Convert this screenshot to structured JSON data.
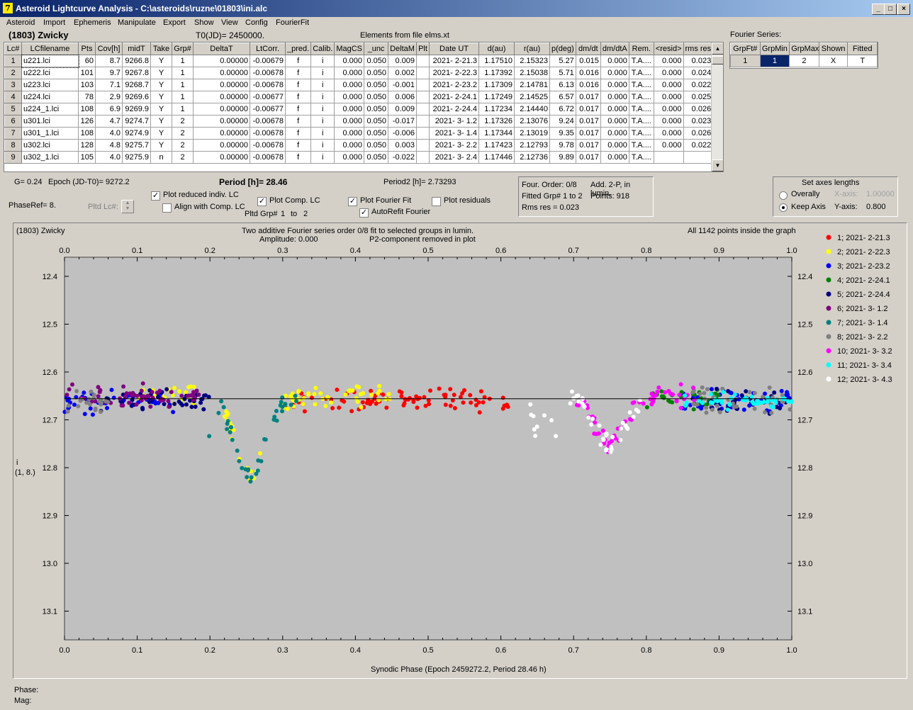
{
  "window": {
    "title": "Asteroid Lightcurve Analysis - C:\\asteroids\\ruzne\\01803\\ini.alc",
    "min": "_",
    "max": "□",
    "close": "×"
  },
  "menu": [
    "Asteroid",
    "Import",
    "Ephemeris",
    "Manipulate",
    "Export",
    "Show",
    "View",
    "Config",
    "FourierFit"
  ],
  "header": {
    "asteroid": "(1803) Zwicky",
    "t0": "T0(JD)= 2450000.",
    "elements": "Elements from file elms.xt",
    "fourier_label": "Fourier Series:"
  },
  "lc_table": {
    "columns": [
      "Lc#",
      "LCfilename",
      "Pts",
      "Cov[h]",
      "midT",
      "Take",
      "Grp#",
      "DeltaT",
      "LtCorr.",
      "_pred.",
      "Calib.",
      "MagCS",
      "_unc",
      "DeltaM",
      "Plt",
      "Date UT",
      "d(au)",
      "r(au)",
      "p(deg)",
      "dm/dt",
      "dm/dtA",
      "Rem.",
      "<resid>",
      "rms res"
    ],
    "rows": [
      [
        "1",
        "u221.lci",
        "60",
        "8.7",
        "9266.8",
        "Y",
        "1",
        "0.00000",
        "-0.00679",
        "f",
        "i",
        "0.000",
        "0.050",
        "0.009",
        "",
        "2021- 2-21.3",
        "1.17510",
        "2.15323",
        "5.27",
        "0.015",
        "0.000",
        "T.A....",
        "0.000",
        "0.023"
      ],
      [
        "2",
        "u222.lci",
        "101",
        "9.7",
        "9267.8",
        "Y",
        "1",
        "0.00000",
        "-0.00678",
        "f",
        "i",
        "0.000",
        "0.050",
        "0.002",
        "",
        "2021- 2-22.3",
        "1.17392",
        "2.15038",
        "5.71",
        "0.016",
        "0.000",
        "T.A....",
        "0.000",
        "0.024"
      ],
      [
        "3",
        "u223.lci",
        "103",
        "7.1",
        "9268.7",
        "Y",
        "1",
        "0.00000",
        "-0.00678",
        "f",
        "i",
        "0.000",
        "0.050",
        "-0.001",
        "",
        "2021- 2-23.2",
        "1.17309",
        "2.14781",
        "6.13",
        "0.016",
        "0.000",
        "T.A....",
        "0.000",
        "0.022"
      ],
      [
        "4",
        "u224.lci",
        "78",
        "2.9",
        "9269.6",
        "Y",
        "1",
        "0.00000",
        "-0.00677",
        "f",
        "i",
        "0.000",
        "0.050",
        "0.006",
        "",
        "2021- 2-24.1",
        "1.17249",
        "2.14525",
        "6.57",
        "0.017",
        "0.000",
        "T.A....",
        "0.000",
        "0.025"
      ],
      [
        "5",
        "u224_1.lci",
        "108",
        "6.9",
        "9269.9",
        "Y",
        "1",
        "0.00000",
        "-0.00677",
        "f",
        "i",
        "0.000",
        "0.050",
        "0.009",
        "",
        "2021- 2-24.4",
        "1.17234",
        "2.14440",
        "6.72",
        "0.017",
        "0.000",
        "T.A....",
        "0.000",
        "0.026"
      ],
      [
        "6",
        "u301.lci",
        "126",
        "4.7",
        "9274.7",
        "Y",
        "2",
        "0.00000",
        "-0.00678",
        "f",
        "i",
        "0.000",
        "0.050",
        "-0.017",
        "",
        "2021- 3- 1.2",
        "1.17326",
        "2.13076",
        "9.24",
        "0.017",
        "0.000",
        "T.A....",
        "0.000",
        "0.023"
      ],
      [
        "7",
        "u301_1.lci",
        "108",
        "4.0",
        "9274.9",
        "Y",
        "2",
        "0.00000",
        "-0.00678",
        "f",
        "i",
        "0.000",
        "0.050",
        "-0.006",
        "",
        "2021- 3- 1.4",
        "1.17344",
        "2.13019",
        "9.35",
        "0.017",
        "0.000",
        "T.A....",
        "0.000",
        "0.026"
      ],
      [
        "8",
        "u302.lci",
        "128",
        "4.8",
        "9275.7",
        "Y",
        "2",
        "0.00000",
        "-0.00678",
        "f",
        "i",
        "0.000",
        "0.050",
        "0.003",
        "",
        "2021- 3- 2.2",
        "1.17423",
        "2.12793",
        "9.78",
        "0.017",
        "0.000",
        "T.A....",
        "0.000",
        "0.022"
      ],
      [
        "9",
        "u302_1.lci",
        "105",
        "4.0",
        "9275.9",
        "n",
        "2",
        "0.00000",
        "-0.00678",
        "f",
        "i",
        "0.000",
        "0.050",
        "-0.022",
        "",
        "2021- 3- 2.4",
        "1.17446",
        "2.12736",
        "9.89",
        "0.017",
        "0.000",
        "T.A....",
        "",
        ""
      ]
    ]
  },
  "fourier_table": {
    "columns": [
      "GrpFt#",
      "GrpMin",
      "GrpMax",
      "Shown",
      "Fitted"
    ],
    "row": [
      "1",
      "1",
      "2",
      "X",
      "T"
    ]
  },
  "params": {
    "g": "G= 0.24",
    "epoch": "Epoch (JD-T0)= 9272.2",
    "period": "Period [h]= 28.46",
    "period2": "Period2 [h]= 2.73293",
    "phaseref": "PhaseRef= 8.",
    "pltd_lc": "Pltd Lc#:",
    "plot_reduced": "Plot reduced indiv. LC",
    "align_comp": "Align with Comp. LC",
    "plot_comp": "Plot Comp. LC",
    "pltd_grp": "Pltd Grp#",
    "grp_from": "1",
    "grp_to_lbl": "to",
    "grp_to": "2",
    "plot_fourier": "Plot Fourier Fit",
    "autorefit": "AutoRefit Fourier",
    "plot_resid": "Plot residuals",
    "four_order": "Four. Order:  0/8",
    "add2p": "Add. 2-P, in lumin.",
    "fitted_grp": "Fitted Grp# 1 to 2",
    "points": "Points: 918",
    "rms": "Rms res     = 0.023",
    "axes_title": "Set axes lengths",
    "overally": "Overally",
    "keep_axis": "Keep Axis",
    "xaxis_lbl": "X-axis:",
    "xaxis_val": "1.00000",
    "yaxis_lbl": "Y-axis:",
    "yaxis_val": "0.800",
    "checks": {
      "plot_reduced": true,
      "align_comp": false,
      "plot_comp": true,
      "plot_fourier": true,
      "autorefit": true,
      "plot_resid": false
    }
  },
  "plot": {
    "name": "(1803) Zwicky",
    "title1": "Two additive Fourier series order 0/8 fit to selected groups in lumin.",
    "title2a": "Amplitude: 0.000",
    "title2b": "P2-component removed in plot",
    "inside": "All 1142 points inside the graph",
    "ylabel1": "i",
    "ylabel2": "(1, 8.)",
    "xlabel": "Synodic Phase (Epoch 2459272.2, Period 28.46 h)",
    "phase_lbl": "Phase:",
    "mag_lbl": "Mag:"
  },
  "chart_data": {
    "type": "scatter",
    "xlabel": "Synodic Phase (Epoch 2459272.2, Period 28.46 h)",
    "ylabel": "i",
    "xlim": [
      0,
      1
    ],
    "ylim": [
      12.36,
      13.16
    ],
    "y_inverted": true,
    "xticks": [
      "0.0",
      "0.1",
      "0.2",
      "0.3",
      "0.4",
      "0.5",
      "0.6",
      "0.7",
      "0.8",
      "0.9",
      "1.0"
    ],
    "yticks": [
      "12.4",
      "12.5",
      "12.6",
      "12.7",
      "12.8",
      "12.9",
      "13.0",
      "13.1"
    ],
    "fit_line_mag": 12.656,
    "series": [
      {
        "name": "1; 2021- 2-21.3",
        "color": "#ff0000",
        "ranges": [
          [
            0.3,
            0.61,
            12.66,
            0.03
          ]
        ]
      },
      {
        "name": "2; 2021- 2-22.3",
        "color": "#ffff00",
        "ranges": [
          [
            0.1,
            0.18,
            12.65,
            0.03
          ],
          [
            0.22,
            0.27,
            12.79,
            0.02
          ],
          [
            0.3,
            0.45,
            12.65,
            0.03
          ]
        ]
      },
      {
        "name": "3; 2021- 2-23.2",
        "color": "#0000ff",
        "ranges": [
          [
            0.0,
            0.15,
            12.66,
            0.03
          ],
          [
            0.85,
            1.0,
            12.66,
            0.03
          ]
        ]
      },
      {
        "name": "4; 2021- 2-24.1",
        "color": "#008000",
        "ranges": [
          [
            0.8,
            0.9,
            12.65,
            0.03
          ]
        ]
      },
      {
        "name": "5; 2021- 2-24.4",
        "color": "#000080",
        "ranges": [
          [
            0.05,
            0.2,
            12.66,
            0.03
          ],
          [
            0.88,
            1.0,
            12.66,
            0.03
          ]
        ]
      },
      {
        "name": "6; 2021- 3- 1.2",
        "color": "#800080",
        "ranges": [
          [
            0.0,
            0.2,
            12.65,
            0.03
          ]
        ]
      },
      {
        "name": "7; 2021- 3- 1.4",
        "color": "#008080",
        "ranges": [
          [
            0.19,
            0.32,
            12.72,
            0.06
          ]
        ]
      },
      {
        "name": "8; 2021- 3- 2.2",
        "color": "#808080",
        "ranges": [
          [
            0.0,
            0.06,
            12.66,
            0.03
          ],
          [
            0.86,
            1.0,
            12.66,
            0.03
          ]
        ]
      },
      {
        "name": "10; 2021- 3- 3.2",
        "color": "#ff00ff",
        "ranges": [
          [
            0.7,
            0.8,
            12.73,
            0.04
          ],
          [
            0.8,
            0.87,
            12.65,
            0.03
          ]
        ]
      },
      {
        "name": "11; 2021- 3- 3.4",
        "color": "#00ffff",
        "ranges": [
          [
            0.85,
            1.0,
            12.66,
            0.02
          ]
        ]
      },
      {
        "name": "12; 2021- 3- 4.3",
        "color": "#ffffff",
        "ranges": [
          [
            0.64,
            0.8,
            12.7,
            0.04
          ]
        ]
      }
    ]
  }
}
